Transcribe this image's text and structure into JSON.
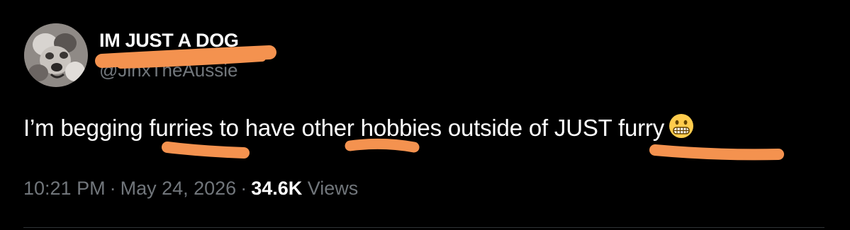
{
  "author": {
    "display_name": "IM JUST A DOG",
    "handle": "@JinxTheAussie"
  },
  "tweet": {
    "text_segments": [
      "I’m begging ",
      "furries",
      " to have ",
      "other",
      " hobbies outside of ",
      "JUST furry"
    ],
    "emoji": "grimacing-face"
  },
  "meta": {
    "time": "10:21 PM",
    "separator": "·",
    "date": "May 24, 2026",
    "views_count": "34.6K",
    "views_label": "Views"
  },
  "colors": {
    "background": "#000000",
    "text": "#ffffff",
    "secondary_text": "#71767b",
    "scribble": "#f4924f",
    "divider": "#2f3336"
  }
}
